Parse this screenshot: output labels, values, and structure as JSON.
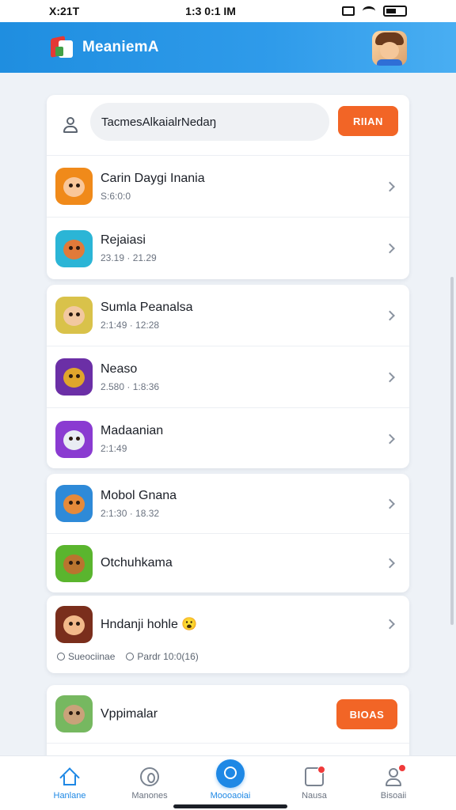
{
  "status_bar": {
    "time_left": "X:21T",
    "time_center": "1:3 0:1 IM"
  },
  "header": {
    "brand": "MeaniemA"
  },
  "search": {
    "value": "TacmesAlkaialrNedaŋ",
    "button_label": "RIIAN"
  },
  "games": [
    {
      "title": "Carin Daygi Inania",
      "subtitle": "S:6:0:0",
      "colors": {
        "bg": "#f08a1a",
        "face": "#f9c79a"
      }
    },
    {
      "title": "Rejaiasi",
      "subtitle": "23.19 · 21.29",
      "colors": {
        "bg": "#2bb5d6",
        "face": "#e07a3a"
      }
    },
    {
      "title": "Sumla Peanalsa",
      "subtitle": "2:1:49 · 12:28",
      "colors": {
        "bg": "#d9c24a",
        "face": "#f2c8a0"
      }
    },
    {
      "title": "Neaso",
      "subtitle": "2.580 · 1:8:36",
      "colors": {
        "bg": "#6b2fa6",
        "face": "#e0a52c"
      }
    },
    {
      "title": "Madaanian",
      "subtitle": "2:1:49",
      "colors": {
        "bg": "#8a3bd1",
        "face": "#e9ecf3"
      }
    },
    {
      "title": "Mobol Gnana",
      "subtitle": "2:1:30 · 18.32",
      "colors": {
        "bg": "#2e8ad8",
        "face": "#e58a3a"
      }
    },
    {
      "title": "Otchuhkama",
      "subtitle": "",
      "colors": {
        "bg": "#5ab52e",
        "face": "#b9742f"
      }
    },
    {
      "title": "Hndanji hohle",
      "subtitle": "",
      "emoji": "😮",
      "colors": {
        "bg": "#7a2e1c",
        "face": "#f2b98a"
      }
    }
  ],
  "meta": {
    "item1": "Sueociinae",
    "item2": "Pardr 10:0(16)"
  },
  "featured": {
    "title": "Vppimalar",
    "button_label": "BIOAS",
    "colors": {
      "bg": "#76b860",
      "face": "#c9a27a"
    }
  },
  "tabs": [
    {
      "label": "Hanlane"
    },
    {
      "label": "Manones"
    },
    {
      "label": "Moooaoiai"
    },
    {
      "label": "Nausa"
    },
    {
      "label": "Bisoaii"
    }
  ]
}
